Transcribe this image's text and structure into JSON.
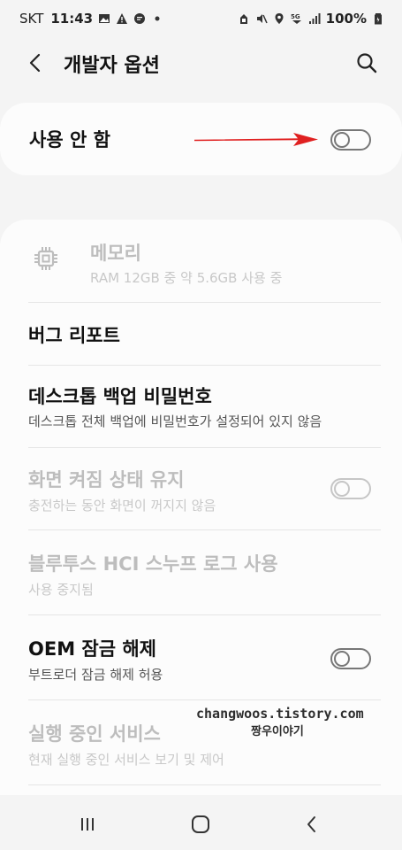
{
  "status_bar": {
    "carrier": "SKT",
    "time": "11:43",
    "battery": "100%",
    "network": "5G"
  },
  "app_bar": {
    "title": "개발자 옵션",
    "back_icon": "back-arrow-icon",
    "search_icon": "search-icon"
  },
  "master": {
    "label": "사용 안 함",
    "toggle_on": false
  },
  "items": [
    {
      "title": "메모리",
      "subtitle": "RAM 12GB 중 약 5.6GB 사용 중",
      "enabled": false,
      "icon": "memory-chip-icon"
    },
    {
      "title": "버그 리포트",
      "enabled": true
    },
    {
      "title": "데스크톱 백업 비밀번호",
      "subtitle": "데스크톱 전체 백업에 비밀번호가 설정되어 있지 않음",
      "enabled": true
    },
    {
      "title": "화면 켜짐 상태 유지",
      "subtitle": "충전하는 동안 화면이 꺼지지 않음",
      "enabled": false,
      "toggle_on": false
    },
    {
      "title": "블루투스 HCI 스누프 로그 사용",
      "subtitle": "사용 중지됨",
      "enabled": false
    },
    {
      "title": "OEM 잠금 해제",
      "subtitle": "부트로더 잠금 해제 허용",
      "enabled": true,
      "toggle_on": false
    },
    {
      "title": "실행 중인 서비스",
      "subtitle": "현재 실행 중인 서비스 보기 및 제어",
      "enabled": false
    }
  ],
  "watermark": {
    "line1": "changwoos.tistory.com",
    "line2": "짱우이야기"
  },
  "colors": {
    "arrow": "#e02020",
    "background": "#f4f4f4",
    "card": "#fcfcfc"
  }
}
